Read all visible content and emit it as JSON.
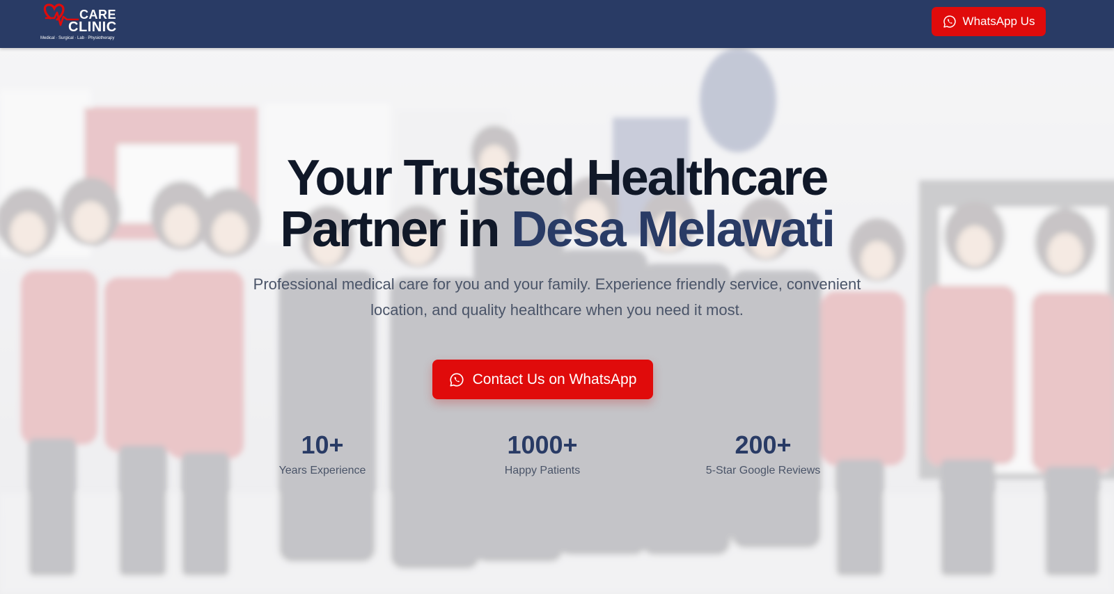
{
  "header": {
    "logo": {
      "care": "CARE",
      "clinic": "CLINIC",
      "tagline": "Medical · Surgical · Lab · Physiotherapy"
    },
    "whatsapp_label": "WhatsApp Us",
    "whatsapp_icon": "whatsapp-icon"
  },
  "hero": {
    "headline_line1": "Your Trusted Healthcare",
    "headline_line2_prefix": "Partner in ",
    "headline_line2_accent": "Desa Melawati",
    "subtext": "Professional medical care for you and your family. Experience friendly service, convenient location, and quality healthcare when you need it most.",
    "cta_label": "Contact Us on WhatsApp",
    "cta_icon": "whatsapp-icon",
    "background_image": "clinic staff team photo"
  },
  "stats": [
    {
      "value": "10+",
      "label": "Years Experience"
    },
    {
      "value": "1000+",
      "label": "Happy Patients"
    },
    {
      "value": "200+",
      "label": "5-Star Google Reviews"
    }
  ],
  "colors": {
    "navy": "#293b65",
    "red": "#e00b0b",
    "heading": "#101828",
    "body_text": "#4a5468"
  }
}
